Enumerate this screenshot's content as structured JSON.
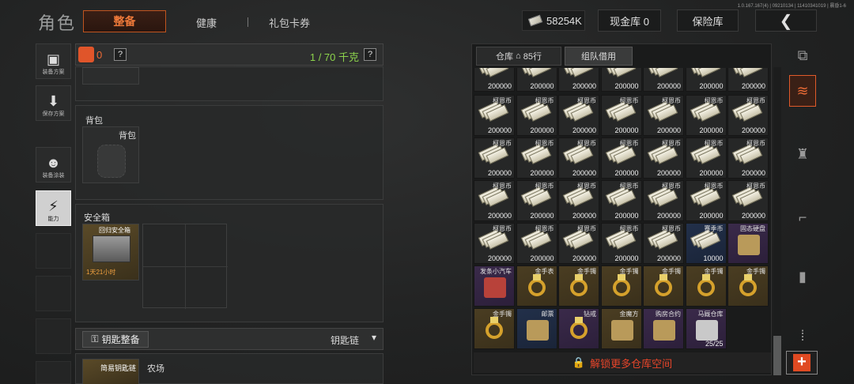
{
  "version_text": "1.0.167.167(4) | 09210134 | 11410341019 | 晨昏1-6",
  "header": {
    "title": "角色",
    "tabs": [
      {
        "label": "整备",
        "active": true
      },
      {
        "label": "健康",
        "active": false
      },
      {
        "label": "礼包卡券",
        "active": false
      }
    ],
    "currency_amount": "58254K",
    "cash_vault": "现金库 0",
    "insurance": "保险库",
    "back_icon": "chevron-left-icon"
  },
  "left_nav": [
    {
      "label": "装备方案",
      "icon": "vest-icon"
    },
    {
      "label": "保存方案",
      "icon": "download-icon"
    },
    {
      "label": "装备涂装",
      "icon": "helmet-icon"
    },
    {
      "label": "能力",
      "icon": "lightning-icon",
      "active": true
    }
  ],
  "gear": {
    "weight_count": "0",
    "weight_help": "?",
    "weight_value": "1 / 70 千克",
    "backpack_section": "背包",
    "backpack_slot": "背包",
    "safe_section": "安全箱",
    "safe_item_name": "回归安全箱",
    "safe_timer": "1天21小时",
    "key_button": "钥匙整备",
    "key_chain": "钥匙链",
    "key_slot_label": "简易钥匙链",
    "key_slot_place": "农场"
  },
  "warehouse": {
    "tab_warehouse": "仓库",
    "tab_rows": "85行",
    "tab_team": "组队借用",
    "unlock": "解锁更多仓库空间",
    "rows": [
      [
        {
          "n": "",
          "c": "200000",
          "t": "cash"
        },
        {
          "n": "",
          "c": "200000",
          "t": "cash"
        },
        {
          "n": "",
          "c": "200000",
          "t": "cash"
        },
        {
          "n": "",
          "c": "200000",
          "t": "cash"
        },
        {
          "n": "",
          "c": "200000",
          "t": "cash"
        },
        {
          "n": "",
          "c": "200000",
          "t": "cash"
        },
        {
          "n": "",
          "c": "200000",
          "t": "cash"
        }
      ],
      [
        {
          "n": "柯恩币",
          "c": "200000",
          "t": "cash"
        },
        {
          "n": "柯恩币",
          "c": "200000",
          "t": "cash"
        },
        {
          "n": "柯恩币",
          "c": "200000",
          "t": "cash"
        },
        {
          "n": "柯恩币",
          "c": "200000",
          "t": "cash"
        },
        {
          "n": "柯恩币",
          "c": "200000",
          "t": "cash"
        },
        {
          "n": "柯恩币",
          "c": "200000",
          "t": "cash"
        },
        {
          "n": "柯恩币",
          "c": "200000",
          "t": "cash"
        }
      ],
      [
        {
          "n": "柯恩币",
          "c": "200000",
          "t": "cash"
        },
        {
          "n": "柯恩币",
          "c": "200000",
          "t": "cash"
        },
        {
          "n": "柯恩币",
          "c": "200000",
          "t": "cash"
        },
        {
          "n": "柯恩币",
          "c": "200000",
          "t": "cash"
        },
        {
          "n": "柯恩币",
          "c": "200000",
          "t": "cash"
        },
        {
          "n": "柯恩币",
          "c": "200000",
          "t": "cash"
        },
        {
          "n": "柯恩币",
          "c": "200000",
          "t": "cash"
        }
      ],
      [
        {
          "n": "柯恩币",
          "c": "200000",
          "t": "cash"
        },
        {
          "n": "柯恩币",
          "c": "200000",
          "t": "cash"
        },
        {
          "n": "柯恩币",
          "c": "200000",
          "t": "cash"
        },
        {
          "n": "柯恩币",
          "c": "200000",
          "t": "cash"
        },
        {
          "n": "柯恩币",
          "c": "200000",
          "t": "cash"
        },
        {
          "n": "柯恩币",
          "c": "200000",
          "t": "cash"
        },
        {
          "n": "柯恩币",
          "c": "200000",
          "t": "cash"
        }
      ],
      [
        {
          "n": "柯恩币",
          "c": "200000",
          "t": "cash"
        },
        {
          "n": "柯恩币",
          "c": "200000",
          "t": "cash"
        },
        {
          "n": "柯恩币",
          "c": "200000",
          "t": "cash"
        },
        {
          "n": "柯恩币",
          "c": "200000",
          "t": "cash"
        },
        {
          "n": "柯恩币",
          "c": "200000",
          "t": "cash"
        },
        {
          "n": "赛季币",
          "c": "10000",
          "t": "cash",
          "bg": "blue"
        },
        {
          "n": "固态硬盘",
          "c": "",
          "t": "box",
          "bg": "purple"
        }
      ],
      [
        {
          "n": "发条小汽车",
          "c": "",
          "t": "car",
          "bg": "purple"
        },
        {
          "n": "金手表",
          "c": "",
          "t": "ring",
          "bg": "gold"
        },
        {
          "n": "金手镯",
          "c": "",
          "t": "ring",
          "bg": "gold"
        },
        {
          "n": "金手镯",
          "c": "",
          "t": "ring",
          "bg": "gold"
        },
        {
          "n": "金手镯",
          "c": "",
          "t": "ring",
          "bg": "gold"
        },
        {
          "n": "金手镯",
          "c": "",
          "t": "ring",
          "bg": "gold"
        },
        {
          "n": "金手镯",
          "c": "",
          "t": "ring",
          "bg": "gold"
        }
      ],
      [
        {
          "n": "金手镯",
          "c": "",
          "t": "ring",
          "bg": "gold"
        },
        {
          "n": "邮票",
          "c": "",
          "t": "box",
          "bg": "blue"
        },
        {
          "n": "钻戒",
          "c": "",
          "t": "ring",
          "bg": "purple"
        },
        {
          "n": "金魔方",
          "c": "",
          "t": "box",
          "bg": "gold"
        },
        {
          "n": "购房合约",
          "c": "",
          "t": "box",
          "bg": "purple"
        },
        {
          "n": "马厩仓库",
          "c": "25/25",
          "t": "key",
          "bg": "purple"
        }
      ]
    ]
  },
  "colors": {
    "accent": "#e86a35",
    "weight_green": "#8cd34c",
    "unlock_red": "#e8452a"
  }
}
